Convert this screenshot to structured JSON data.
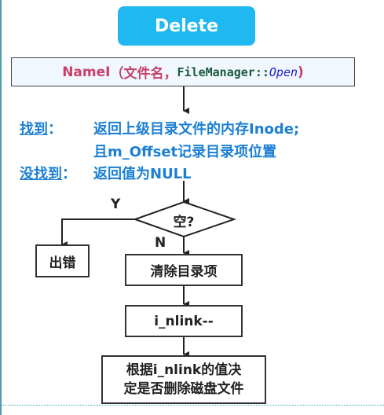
{
  "title": "Delete",
  "call": {
    "name": "NameI",
    "open_paren": "（",
    "arg1": "文件名",
    "comma": "，",
    "arg2": "FileManager::",
    "arg3": "Open",
    "close_paren": ")"
  },
  "result": {
    "found_label": "找到",
    "found_colon": "：",
    "found_line1": "返回上级目录文件的内存Inode;",
    "found_line2": "且m_Offset记录目录项位置",
    "notfound_label": "没找到",
    "notfound_colon": "：",
    "notfound_text": "返回值为NULL"
  },
  "decision": {
    "text": "空?",
    "yes": "Y",
    "no": "N"
  },
  "error_box": "出错",
  "step1": "清除目录项",
  "step2": "i_nlink--",
  "step3_line1": "根据i_nlink的值决",
  "step3_line2": "定是否删除磁盘文件",
  "colors": {
    "button": "#1fb8f0",
    "name_magenta": "#c8406a",
    "result_blue": "#1a7fd4"
  }
}
